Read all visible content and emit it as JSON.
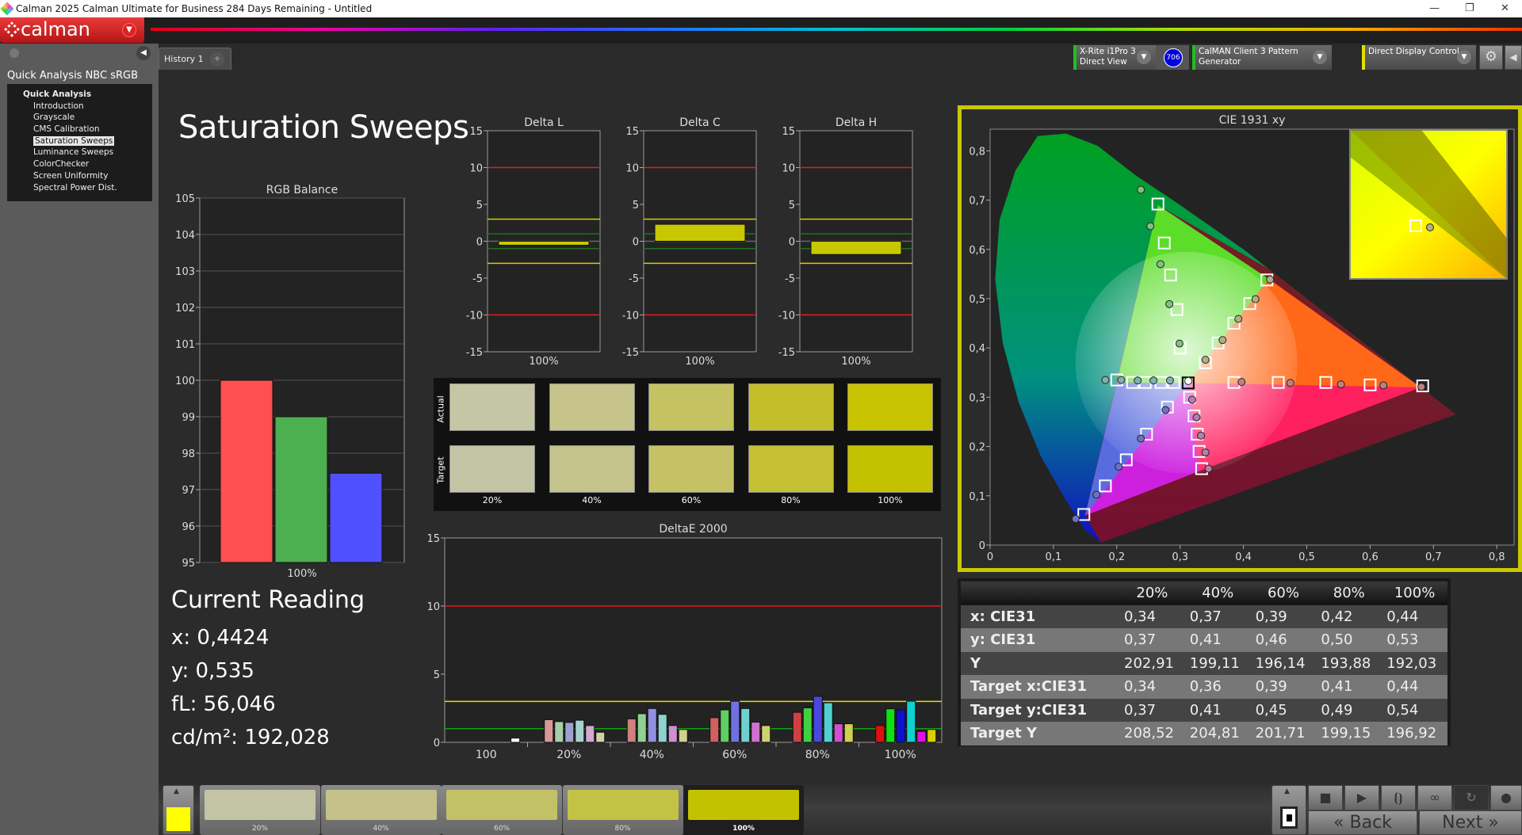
{
  "window": {
    "title": "Calman 2025 Calman Ultimate for Business 284 Days Remaining  - Untitled",
    "minimize": "—",
    "restore": "❐",
    "close": "✕"
  },
  "logo": {
    "text": "calman",
    "icon": "calman-diamond-logo"
  },
  "sidebar": {
    "workflow_title": "Quick Analysis NBC sRGB",
    "items": [
      {
        "label": "Quick Analysis",
        "head": true
      },
      {
        "label": "Introduction"
      },
      {
        "label": "Grayscale"
      },
      {
        "label": "CMS Calibration"
      },
      {
        "label": "Saturation Sweeps",
        "selected": true
      },
      {
        "label": "Luminance Sweeps"
      },
      {
        "label": "ColorChecker"
      },
      {
        "label": "Screen Uniformity"
      },
      {
        "label": "Spectral Power Dist."
      }
    ]
  },
  "tabs": [
    {
      "label": "History 1"
    },
    {
      "label": "+"
    }
  ],
  "devices": {
    "meter": {
      "line1": "X-Rite i1Pro 3",
      "line2": "Direct View",
      "badge": "706",
      "status_color": "#1ec01e"
    },
    "pattern": {
      "label": "CalMAN Client 3 Pattern Generator",
      "status_color": "#1ec01e"
    },
    "display": {
      "label": "Direct Display Control",
      "status_color": "#e0e000"
    }
  },
  "page_title": "Saturation Sweeps",
  "rgb_balance": {
    "title": "RGB Balance",
    "type": "bar",
    "categories": [
      "100%"
    ],
    "ylim": [
      95,
      105
    ],
    "yticks": [
      "95",
      "96",
      "97",
      "98",
      "99",
      "100",
      "101",
      "102",
      "103",
      "104",
      "105"
    ],
    "series": [
      {
        "name": "R",
        "value": 100.0,
        "color": "#ff4f4f"
      },
      {
        "name": "G",
        "value": 99.0,
        "color": "#4caf50"
      },
      {
        "name": "B",
        "value": 97.45,
        "color": "#5050ff"
      }
    ]
  },
  "delta_charts": [
    {
      "title": "Delta L",
      "value": -0.4,
      "xlabel": "100%"
    },
    {
      "title": "Delta C",
      "value": 2.3,
      "xlabel": "100%"
    },
    {
      "title": "Delta H",
      "value": -1.8,
      "xlabel": "100%"
    }
  ],
  "delta_ylim": [
    -15,
    15
  ],
  "delta_yticks": [
    "15",
    "10",
    "5",
    "0",
    "-5",
    "-10",
    "-15"
  ],
  "swatches": {
    "row_labels": [
      "Actual",
      "Target"
    ],
    "labels": [
      "20%",
      "40%",
      "60%",
      "80%",
      "100%"
    ],
    "actual": [
      "#c5c6a4",
      "#c6c48a",
      "#c5c262",
      "#c3be2a",
      "#c8c300"
    ],
    "target": [
      "#c3c4a3",
      "#c5c38c",
      "#c5c266",
      "#c4c032",
      "#c4c200"
    ]
  },
  "deltae": {
    "title": "DeltaE 2000",
    "type": "bar",
    "ylim": [
      0,
      15
    ],
    "yticks": [
      "0",
      "5",
      "10",
      "15"
    ],
    "thresholds": [
      {
        "value": 10,
        "color": "#e02020"
      },
      {
        "value": 3,
        "color": "#e0e000"
      },
      {
        "value": 1,
        "color": "#10a010"
      }
    ],
    "categories": [
      "100",
      "20%",
      "40%",
      "60%",
      "80%",
      "100%"
    ],
    "groups": [
      {
        "values": [
          0.31
        ],
        "colors": [
          "#ffffff"
        ]
      },
      {
        "values": [
          1.66,
          1.52,
          1.46,
          1.62,
          1.23,
          0.74
        ],
        "colors": [
          "#d89898",
          "#a8d0a8",
          "#a0a0d0",
          "#a8d0d0",
          "#d0a8d0",
          "#d0d0a8"
        ]
      },
      {
        "values": [
          1.72,
          2.1,
          2.48,
          2.05,
          1.23,
          0.94
        ],
        "colors": [
          "#d08080",
          "#90d090",
          "#9090e0",
          "#90d0d0",
          "#d090d0",
          "#d0d090"
        ]
      },
      {
        "values": [
          1.81,
          2.38,
          3.02,
          2.48,
          1.48,
          1.23
        ],
        "colors": [
          "#d06060",
          "#60d060",
          "#7070e0",
          "#70d0d0",
          "#d070d0",
          "#d0d070"
        ]
      },
      {
        "values": [
          2.2,
          2.53,
          3.37,
          2.9,
          1.36,
          1.36
        ],
        "colors": [
          "#d04040",
          "#40d040",
          "#4848e0",
          "#50d0d0",
          "#d050d0",
          "#d0d050"
        ]
      },
      {
        "values": [
          1.23,
          2.46,
          2.38,
          3.02,
          0.8,
          0.94
        ],
        "colors": [
          "#e01010",
          "#10e010",
          "#1010d0",
          "#10d0d0",
          "#e010e0",
          "#d8d000"
        ]
      }
    ]
  },
  "current_reading": {
    "title": "Current Reading",
    "x": "x: 0,4424",
    "y": "y: 0,535",
    "fl": "fL: 56,046",
    "cdm2": "cd/m²: 192,028"
  },
  "cie": {
    "title": "CIE 1931 xy",
    "type": "scatter",
    "xlim": [
      0,
      0.84
    ],
    "ylim": [
      0,
      0.84
    ],
    "xticks": [
      "0",
      "0,1",
      "0,2",
      "0,3",
      "0,4",
      "0,5",
      "0,6",
      "0,7",
      "0,8"
    ],
    "yticks": [
      "0",
      "0,1",
      "0,2",
      "0,3",
      "0,4",
      "0,5",
      "0,6",
      "0,7",
      "0,8"
    ],
    "white": {
      "target": [
        0.3127,
        0.329
      ],
      "measured": [
        0.313,
        0.333
      ]
    },
    "series": [
      {
        "color": "#80c080",
        "targets": [
          [
            0.3,
            0.4
          ],
          [
            0.295,
            0.478
          ],
          [
            0.285,
            0.548
          ],
          [
            0.275,
            0.613
          ],
          [
            0.265,
            0.692
          ]
        ],
        "measured": [
          [
            0.299,
            0.409
          ],
          [
            0.283,
            0.489
          ],
          [
            0.269,
            0.57
          ],
          [
            0.253,
            0.647
          ],
          [
            0.238,
            0.721
          ]
        ]
      },
      {
        "color": "#80b0b0",
        "targets": [
          [
            0.29,
            0.33
          ],
          [
            0.27,
            0.33
          ],
          [
            0.245,
            0.33
          ],
          [
            0.225,
            0.33
          ],
          [
            0.2,
            0.335
          ]
        ],
        "measured": [
          [
            0.284,
            0.334
          ],
          [
            0.258,
            0.334
          ],
          [
            0.233,
            0.334
          ],
          [
            0.207,
            0.335
          ],
          [
            0.182,
            0.335
          ]
        ]
      },
      {
        "color": "#c08080",
        "targets": [
          [
            0.385,
            0.33
          ],
          [
            0.455,
            0.33
          ],
          [
            0.53,
            0.33
          ],
          [
            0.6,
            0.325
          ],
          [
            0.683,
            0.323
          ]
        ],
        "measured": [
          [
            0.397,
            0.331
          ],
          [
            0.474,
            0.329
          ],
          [
            0.554,
            0.326
          ],
          [
            0.621,
            0.324
          ],
          [
            0.681,
            0.321
          ]
        ]
      },
      {
        "color": "#b0b080",
        "targets": [
          [
            0.34,
            0.37
          ],
          [
            0.36,
            0.41
          ],
          [
            0.385,
            0.45
          ],
          [
            0.41,
            0.49
          ],
          [
            0.437,
            0.538
          ]
        ],
        "measured": [
          [
            0.34,
            0.376
          ],
          [
            0.367,
            0.416
          ],
          [
            0.392,
            0.459
          ],
          [
            0.419,
            0.499
          ],
          [
            0.442,
            0.539
          ]
        ]
      },
      {
        "color": "#b080b0",
        "targets": [
          [
            0.315,
            0.3
          ],
          [
            0.322,
            0.262
          ],
          [
            0.327,
            0.225
          ],
          [
            0.33,
            0.19
          ],
          [
            0.334,
            0.155
          ]
        ],
        "measured": [
          [
            0.319,
            0.295
          ],
          [
            0.326,
            0.259
          ],
          [
            0.333,
            0.222
          ],
          [
            0.34,
            0.188
          ],
          [
            0.345,
            0.155
          ]
        ]
      },
      {
        "color": "#7070c0",
        "targets": [
          [
            0.28,
            0.28
          ],
          [
            0.247,
            0.225
          ],
          [
            0.215,
            0.173
          ],
          [
            0.182,
            0.12
          ],
          [
            0.148,
            0.062
          ]
        ],
        "measured": [
          [
            0.277,
            0.274
          ],
          [
            0.238,
            0.216
          ],
          [
            0.203,
            0.159
          ],
          [
            0.168,
            0.102
          ],
          [
            0.135,
            0.053
          ]
        ]
      }
    ]
  },
  "table": {
    "columns": [
      "",
      "20%",
      "40%",
      "60%",
      "80%",
      "100%"
    ],
    "rows": [
      {
        "label": "x: CIE31",
        "values": [
          "0,34",
          "0,37",
          "0,39",
          "0,42",
          "0,44"
        ]
      },
      {
        "label": "y: CIE31",
        "values": [
          "0,37",
          "0,41",
          "0,46",
          "0,50",
          "0,53"
        ]
      },
      {
        "label": "Y",
        "values": [
          "202,91",
          "199,11",
          "196,14",
          "193,88",
          "192,03"
        ]
      },
      {
        "label": "Target x:CIE31",
        "values": [
          "0,34",
          "0,36",
          "0,39",
          "0,41",
          "0,44"
        ]
      },
      {
        "label": "Target y:CIE31",
        "values": [
          "0,37",
          "0,41",
          "0,45",
          "0,49",
          "0,54"
        ]
      },
      {
        "label": "Target Y",
        "values": [
          "208,52",
          "204,81",
          "201,71",
          "199,15",
          "196,92"
        ]
      }
    ]
  },
  "bottom": {
    "current_color": "#ffff00",
    "swatches": [
      {
        "label": "20%",
        "color": "#c3c4a3"
      },
      {
        "label": "40%",
        "color": "#c4c28a"
      },
      {
        "label": "60%",
        "color": "#c3c166"
      },
      {
        "label": "80%",
        "color": "#c2c245"
      },
      {
        "label": "100%",
        "color": "#c4c200",
        "selected": true
      }
    ],
    "back": "Back",
    "next": "Next"
  }
}
